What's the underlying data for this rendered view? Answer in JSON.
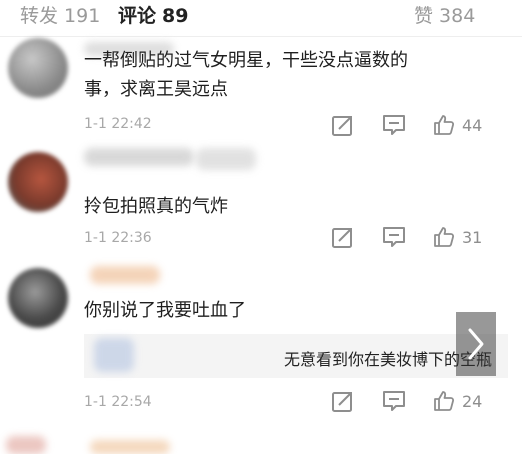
{
  "tabs": {
    "repost": {
      "label": "转发",
      "count": "191"
    },
    "comment": {
      "label": "评论",
      "count": "89"
    },
    "like": {
      "label": "赞",
      "count": "384"
    }
  },
  "comments": [
    {
      "text_line1": "一帮倒贴的过气女明星，干些没点逼数的",
      "text_line2": "事，求离王昊远点",
      "time": "1-1 22:42",
      "likes": "44"
    },
    {
      "text_line1": "拎包拍照真的气炸",
      "time": "1-1 22:36",
      "likes": "31"
    },
    {
      "text_line1": "你别说了我要吐血了",
      "reply": "无意看到你在美妆博下的空瓶",
      "time": "1-1 22:54",
      "likes": "24"
    }
  ],
  "icons": {
    "share": "share-icon",
    "reply": "comment-icon",
    "like": "thumbs-up-icon",
    "next": "chevron-right-icon",
    "emoji": "emoji-icon"
  },
  "colors": {
    "muted": "#9a9a9a",
    "text": "#1f1f1f",
    "reply_bg": "#f4f4f4"
  }
}
